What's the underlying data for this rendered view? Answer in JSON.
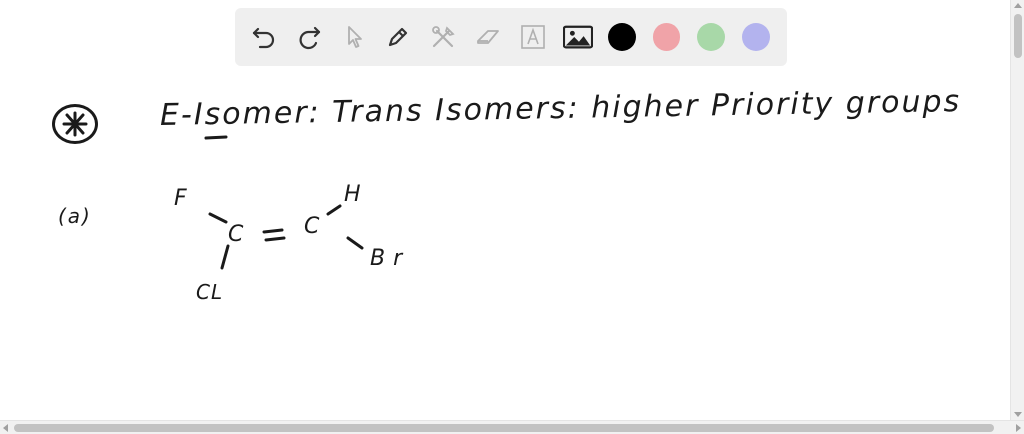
{
  "toolbar": {
    "tools": [
      {
        "name": "undo-icon",
        "label": "Undo"
      },
      {
        "name": "redo-icon",
        "label": "Redo"
      },
      {
        "name": "pointer-icon",
        "label": "Select"
      },
      {
        "name": "pen-icon",
        "label": "Pen"
      },
      {
        "name": "tools-icon",
        "label": "Tools"
      },
      {
        "name": "eraser-icon",
        "label": "Eraser"
      },
      {
        "name": "text-icon",
        "label": "A"
      },
      {
        "name": "image-icon",
        "label": "Image"
      }
    ],
    "colors": [
      "#000000",
      "#f0a3a8",
      "#a8d8a8",
      "#b3b3ee"
    ],
    "selected_color": "#000000"
  },
  "notes": {
    "heading": "E-Isomer: Trans Isomers: higher Priority groups",
    "part": "(a)",
    "atoms": {
      "top_left": "F",
      "left_carbon": "C",
      "right_carbon": "C",
      "top_right": "H",
      "bottom_right": "Br",
      "bottom_left": "CL"
    }
  }
}
